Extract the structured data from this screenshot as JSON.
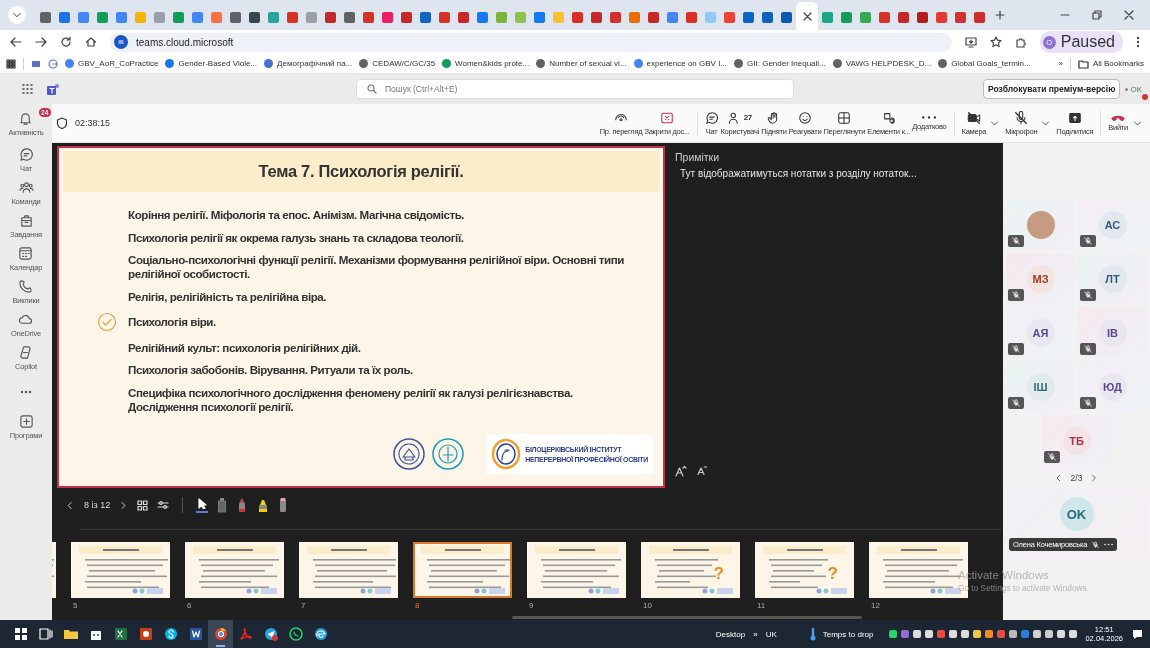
{
  "browser": {
    "tabs": [
      {
        "selected": false,
        "color": "#5f6368"
      },
      {
        "selected": false,
        "color": "#1a73e8"
      },
      {
        "selected": false,
        "color": "#4285f4"
      },
      {
        "selected": false,
        "color": "#0f9d58"
      },
      {
        "selected": false,
        "color": "#4285f4"
      },
      {
        "selected": false,
        "color": "#f4b400"
      },
      {
        "selected": false,
        "color": "#9aa0a6"
      },
      {
        "selected": false,
        "color": "#0f9d58"
      },
      {
        "selected": false,
        "color": "#4285f4"
      },
      {
        "selected": false,
        "color": "#ff7043"
      },
      {
        "selected": false,
        "color": "#5f6368"
      },
      {
        "selected": false,
        "color": "#37474f"
      },
      {
        "selected": false,
        "color": "#26a69a"
      },
      {
        "selected": false,
        "color": "#d93025"
      },
      {
        "selected": false,
        "color": "#9aa0a6"
      },
      {
        "selected": false,
        "color": "#c62828"
      },
      {
        "selected": false,
        "color": "#616161"
      },
      {
        "selected": false,
        "color": "#d93025"
      },
      {
        "selected": false,
        "color": "#e91e63"
      },
      {
        "selected": false,
        "color": "#c62828"
      },
      {
        "selected": false,
        "color": "#1565c0"
      },
      {
        "selected": false,
        "color": "#d93025"
      },
      {
        "selected": false,
        "color": "#c62828"
      },
      {
        "selected": false,
        "color": "#1877f2"
      },
      {
        "selected": false,
        "color": "#7cb342"
      },
      {
        "selected": false,
        "color": "#8bc34a"
      },
      {
        "selected": false,
        "color": "#1877f2"
      },
      {
        "selected": false,
        "color": "#fbc02d"
      },
      {
        "selected": false,
        "color": "#d93025"
      },
      {
        "selected": false,
        "color": "#c62828"
      },
      {
        "selected": false,
        "color": "#d32f2f"
      },
      {
        "selected": false,
        "color": "#ef6c00"
      },
      {
        "selected": false,
        "color": "#c62828"
      },
      {
        "selected": false,
        "color": "#4285f4"
      },
      {
        "selected": false,
        "color": "#d93025"
      },
      {
        "selected": false,
        "color": "#90caf9"
      },
      {
        "selected": false,
        "color": "#ea4335"
      },
      {
        "selected": false,
        "color": "#0a66c2"
      },
      {
        "selected": false,
        "color": "#0b63bd"
      },
      {
        "selected": false,
        "color": "#0a5cb0"
      },
      {
        "selected": true
      },
      {
        "selected": false,
        "color": "#1ba784"
      },
      {
        "selected": false,
        "color": "#0f9d58"
      },
      {
        "selected": false,
        "color": "#34a853"
      },
      {
        "selected": false,
        "color": "#d93025"
      },
      {
        "selected": false,
        "color": "#c62828"
      },
      {
        "selected": false,
        "color": "#b71c1c"
      },
      {
        "selected": false,
        "color": "#e53935"
      },
      {
        "selected": false,
        "color": "#d32f2f"
      },
      {
        "selected": false,
        "color": "#c9302c"
      }
    ],
    "address": "teams.cloud.microsoft",
    "profile": {
      "initial": "O",
      "label": "Paused"
    },
    "bookmarks": [
      {
        "label": "GBV_AoR_CoPractice"
      },
      {
        "label": "Gender-Based Viole..."
      },
      {
        "label": "Демографічний па..."
      },
      {
        "label": "CEDAW/C/GC/35"
      },
      {
        "label": "Women&kids prote..."
      },
      {
        "label": "Number of sexual vi..."
      },
      {
        "label": "experience on GBV I..."
      },
      {
        "label": "GII: Gender Inequali..."
      },
      {
        "label": "VAWG HELPDESK_D..."
      },
      {
        "label": "Global Goals_termin..."
      }
    ],
    "bookmarks_more": "»",
    "all_bookmarks": "All Bookmarks"
  },
  "teams": {
    "search": {
      "placeholder": "Пошук (Ctrl+Alt+E)"
    },
    "premium_button": "Розблокувати преміум-версію",
    "account": {
      "initials": "OK"
    }
  },
  "sidebar": {
    "activity": {
      "label": "Активність",
      "badge": "24"
    },
    "items": [
      {
        "label": "Чат"
      },
      {
        "label": "Команди"
      },
      {
        "label": "Завдання"
      },
      {
        "label": "Календар"
      },
      {
        "label": "Виклики"
      },
      {
        "label": "OneDrive"
      },
      {
        "label": "Copilot"
      }
    ],
    "apps": {
      "label": "Програми"
    }
  },
  "meeting": {
    "timer": "02:38:15",
    "toolbar": [
      {
        "label": "Пр. перегляд"
      },
      {
        "label": "Закрити дос..."
      },
      {
        "label": "Чат"
      },
      {
        "label": "Користувачі",
        "count": "27"
      },
      {
        "label": "Підняти"
      },
      {
        "label": "Реагувати"
      },
      {
        "label": "Переглянути"
      },
      {
        "label": "Елементи к..."
      },
      {
        "label": "Додатково"
      }
    ],
    "devices": [
      {
        "label": "Камера",
        "on": false
      },
      {
        "label": "Мікрофон",
        "on": false
      }
    ],
    "share": {
      "label": "Поділитися"
    },
    "leave": {
      "label": "Вийти"
    }
  },
  "slide": {
    "title": "Тема 7. Психологія релігії.",
    "bullets": [
      {
        "text": "Коріння релігії. Міфологія та епос. Анімізм. Магічна свідомість.",
        "checked": false
      },
      {
        "text": "Психологія релігії як окрема галузь знань та складова теології.",
        "checked": false
      },
      {
        "text": "Соціально-психологічні функції релігії. Механізми формування релігійної віри. Основні типи релігійної особистості.",
        "checked": false
      },
      {
        "text": "Релігія, релігійність та релігійна віра.",
        "checked": false
      },
      {
        "text": "Психологія віри.",
        "checked": true
      },
      {
        "text": "Релігійний культ: психологія релігійних дій.",
        "checked": false
      },
      {
        "text": "Психологія забобонів. Вірування. Ритуали та їх роль.",
        "checked": false
      },
      {
        "text": "Специфіка психологічного дослідження феномену релігії як галузі релігієзнавства. Дослідження психології релігії.",
        "checked": false
      }
    ],
    "logo_text": [
      "БІЛОЦЕРКІВСЬКИЙ ІНСТИТУТ",
      "НЕПЕРЕРВНОЇ ПРОФЕСІЙНОЇ ОСВІТИ"
    ]
  },
  "notes": {
    "title": "Примітки",
    "text": "Тут відображатимуться нотатки з розділу нотаток..."
  },
  "slide_counter": "8 із 12",
  "thumbnails": [
    {
      "selected": false
    },
    {
      "number": "5",
      "selected": false
    },
    {
      "number": "6",
      "selected": false
    },
    {
      "number": "7",
      "selected": false
    },
    {
      "number": "8",
      "selected": true
    },
    {
      "number": "9",
      "selected": false
    },
    {
      "number": "10",
      "selected": false,
      "mark": "?"
    },
    {
      "number": "11",
      "selected": false,
      "mark": "?"
    },
    {
      "number": "12",
      "selected": false
    }
  ],
  "participants": [
    {
      "kind": "photo",
      "muted": true
    },
    {
      "kind": "initials",
      "initials": "АС",
      "color": "#2e5d7d",
      "muted": true
    },
    {
      "kind": "initials",
      "initials": "МЗ",
      "color": "#a23b2b",
      "muted": true
    },
    {
      "kind": "initials",
      "initials": "ЛТ",
      "color": "#2e5d7d",
      "muted": true
    },
    {
      "kind": "initials",
      "initials": "АЯ",
      "color": "#5a4a8c",
      "muted": true
    },
    {
      "kind": "initials",
      "initials": "ІВ",
      "color": "#5a4a8c",
      "muted": true
    },
    {
      "kind": "initials",
      "initials": "ІШ",
      "color": "#2d6b7a",
      "muted": true
    },
    {
      "kind": "initials",
      "initials": "ЮД",
      "color": "#5a4a8c",
      "muted": true
    },
    {
      "kind": "initials",
      "initials": "ТБ",
      "color": "#a6304c",
      "muted": true
    }
  ],
  "pager": "2/3",
  "self": {
    "initials": "OK",
    "name": "Олена Кочемировська",
    "muted": true
  },
  "activation": {
    "title": "Activate Windows",
    "text": "Go to Settings to activate Windows."
  },
  "taskbar": {
    "desktop": "Desktop",
    "more": "»",
    "language": "UK",
    "weather": "Temps to drop",
    "time": "12:51",
    "date": "02.04.2026"
  }
}
